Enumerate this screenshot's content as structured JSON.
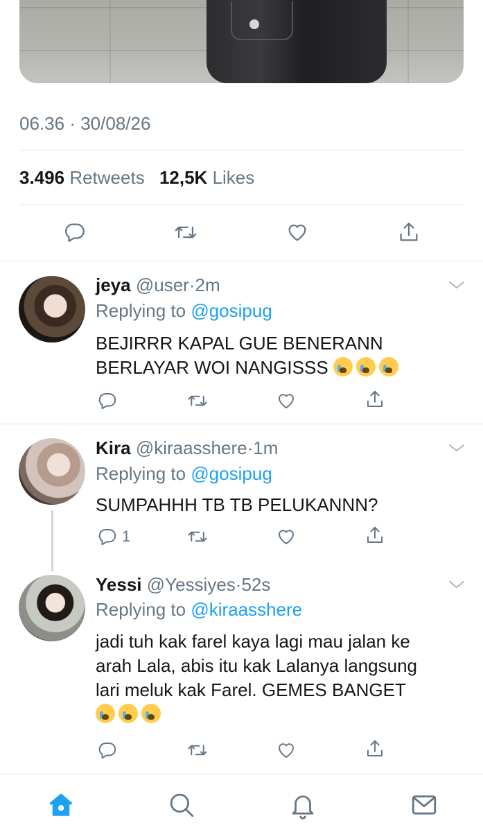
{
  "tweet": {
    "time": "06.36",
    "separator": "·",
    "date": "30/08/26",
    "retweets_count": "3.496",
    "retweets_label": "Retweets",
    "likes_count": "12,5K",
    "likes_label": "Likes"
  },
  "replies": [
    {
      "name": "jeya",
      "handle": "@user",
      "dot": "·",
      "age": "2m",
      "replying_label": "Replying to",
      "replying_to": "@gosipug",
      "line1": "BEJIRRR KAPAL GUE BENERANN",
      "line2": "BERLAYAR WOI NANGISSS",
      "emoji": "loudly-crying-face",
      "reply_count": ""
    },
    {
      "name": "Kira",
      "handle": "@kiraasshere",
      "dot": "·",
      "age": "1m",
      "replying_label": "Replying to",
      "replying_to": "@gosipug",
      "line1": "SUMPAHHH TB TB PELUKANNN?",
      "reply_count": "1"
    },
    {
      "name": "Yessi",
      "handle": "@Yessiyes",
      "dot": "·",
      "age": "52s",
      "replying_label": "Replying to",
      "replying_to": "@kiraasshere",
      "line1": "jadi tuh kak farel kaya lagi mau jalan ke",
      "line2": "arah Lala, abis itu kak Lalanya langsung",
      "line3": "lari meluk kak Farel. GEMES BANGET",
      "emoji": "loudly-crying-face",
      "reply_count": ""
    }
  ],
  "icons": {
    "reply": "speech-bubble-icon",
    "retweet": "retweet-icon",
    "like": "heart-icon",
    "share": "share-icon",
    "more": "chevron-down-icon"
  },
  "tabbar": [
    "home-icon",
    "search-icon",
    "notifications-icon",
    "messages-icon"
  ],
  "colors": {
    "accent": "#1da1f2",
    "secondary_text": "#657786",
    "icon_gray": "#657786",
    "divider": "#e1e8ed",
    "emoji_face": "#ffcc4d"
  }
}
